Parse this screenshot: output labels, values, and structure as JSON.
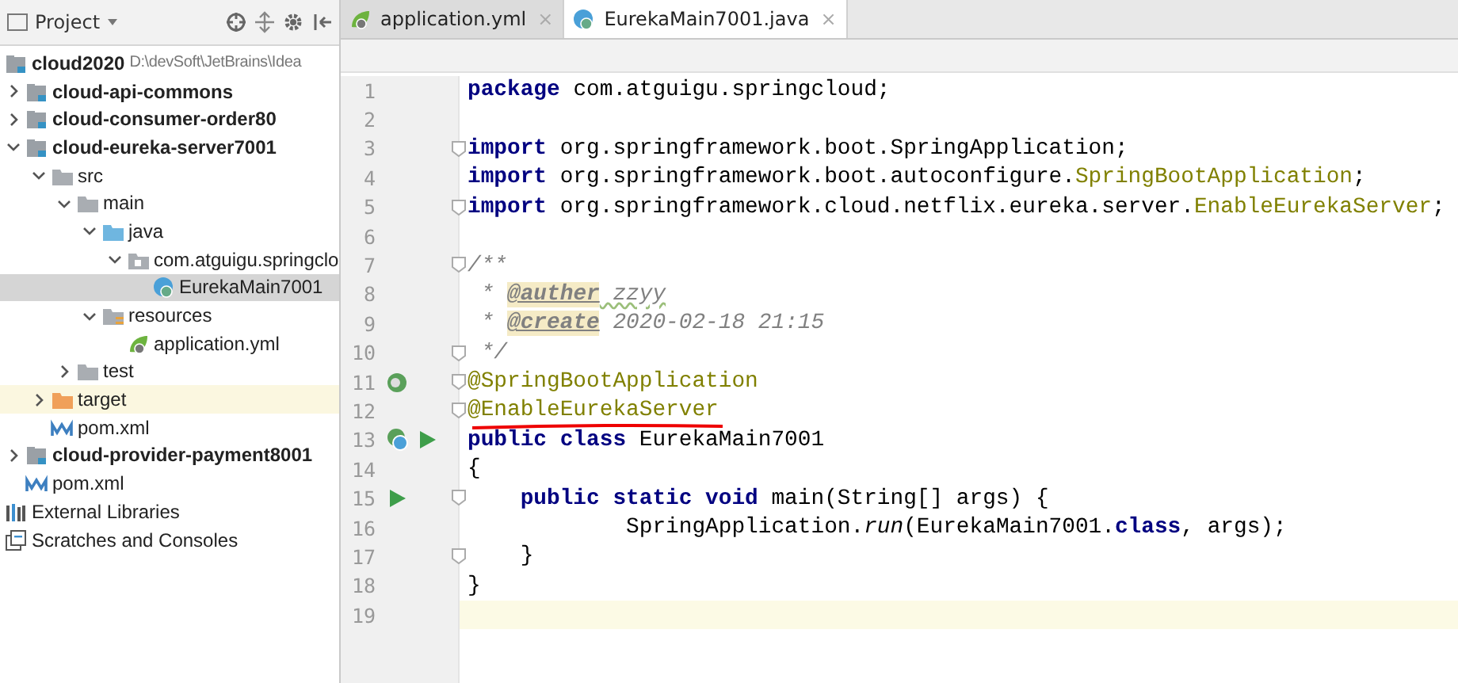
{
  "project_panel": {
    "title": "Project",
    "tree": [
      {
        "label": "cloud2020",
        "suffix": "D:\\devSoft\\JetBrains\\Idea",
        "kind": "module",
        "bold": true,
        "selected": false,
        "highlighted": false,
        "children": [
          {
            "label": "cloud-api-commons",
            "kind": "module",
            "bold": true,
            "expanded": false,
            "selected": false,
            "highlighted": false
          },
          {
            "label": "cloud-consumer-order80",
            "kind": "module",
            "bold": true,
            "expanded": false,
            "selected": false,
            "highlighted": false
          },
          {
            "label": "cloud-eureka-server7001",
            "kind": "module",
            "bold": true,
            "expanded": true,
            "selected": false,
            "highlighted": false,
            "children": [
              {
                "label": "src",
                "kind": "folder",
                "bold": false,
                "expanded": true,
                "selected": false,
                "highlighted": false,
                "children": [
                  {
                    "label": "main",
                    "kind": "folder",
                    "bold": false,
                    "expanded": true,
                    "selected": false,
                    "highlighted": false,
                    "children": [
                      {
                        "label": "java",
                        "kind": "source",
                        "bold": false,
                        "expanded": true,
                        "selected": false,
                        "highlighted": false,
                        "children": [
                          {
                            "label": "com.atguigu.springclo",
                            "kind": "package",
                            "bold": false,
                            "expanded": true,
                            "selected": false,
                            "highlighted": false,
                            "children": [
                              {
                                "label": "EurekaMain7001",
                                "kind": "class",
                                "bold": false,
                                "selected": true,
                                "highlighted": false
                              }
                            ]
                          }
                        ]
                      },
                      {
                        "label": "resources",
                        "kind": "resources",
                        "bold": false,
                        "expanded": true,
                        "selected": false,
                        "highlighted": false,
                        "children": [
                          {
                            "label": "application.yml",
                            "kind": "yml",
                            "bold": false,
                            "selected": false,
                            "highlighted": false
                          }
                        ]
                      }
                    ]
                  },
                  {
                    "label": "test",
                    "kind": "folder",
                    "bold": false,
                    "expanded": false,
                    "selected": false,
                    "highlighted": false
                  }
                ]
              },
              {
                "label": "target",
                "kind": "excluded",
                "bold": false,
                "expanded": false,
                "selected": false,
                "highlighted": true
              },
              {
                "label": "pom.xml",
                "kind": "maven",
                "bold": false,
                "selected": false,
                "highlighted": false
              }
            ]
          },
          {
            "label": "cloud-provider-payment8001",
            "kind": "module",
            "bold": true,
            "expanded": false,
            "selected": false,
            "highlighted": false
          },
          {
            "label": "pom.xml",
            "kind": "maven",
            "bold": false,
            "selected": false,
            "highlighted": false
          }
        ]
      },
      {
        "label": "External Libraries",
        "kind": "libraries",
        "bold": false,
        "selected": false,
        "highlighted": false
      },
      {
        "label": "Scratches and Consoles",
        "kind": "scratches",
        "bold": false,
        "selected": false,
        "highlighted": false
      }
    ]
  },
  "editor": {
    "tabs": [
      {
        "label": "application.yml",
        "kind": "yml",
        "close": "×",
        "selected": false
      },
      {
        "label": "EurekaMain7001.java",
        "kind": "class",
        "close": "×",
        "selected": true
      }
    ],
    "lines": [
      {
        "number": "1",
        "tokens": [
          {
            "kind": "kw",
            "text": "package"
          },
          {
            "kind": "plain",
            "text": " com.atguigu.springcloud;"
          }
        ]
      },
      {
        "number": "2"
      },
      {
        "number": "3",
        "fold": true,
        "tokens": [
          {
            "kind": "kw",
            "text": "import"
          },
          {
            "kind": "plain",
            "text": " org.springframework.boot.SpringApplication;"
          }
        ]
      },
      {
        "number": "4",
        "tokens": [
          {
            "kind": "kw",
            "text": "import"
          },
          {
            "kind": "plain",
            "text": " org.springframework.boot.autoconfigure."
          },
          {
            "kind": "ann",
            "text": "SpringBootApplication"
          },
          {
            "kind": "plain",
            "text": ";"
          }
        ]
      },
      {
        "number": "5",
        "fold": true,
        "tokens": [
          {
            "kind": "kw",
            "text": "import"
          },
          {
            "kind": "plain",
            "text": " org.springframework.cloud.netflix.eureka.server."
          },
          {
            "kind": "ann",
            "text": "EnableEurekaServer"
          },
          {
            "kind": "plain",
            "text": ";"
          }
        ]
      },
      {
        "number": "6"
      },
      {
        "number": "7",
        "fold": true,
        "tokens": [
          {
            "kind": "comment",
            "text": "/**"
          }
        ]
      },
      {
        "number": "8",
        "tokens": [
          {
            "kind": "comment",
            "text": " * "
          },
          {
            "kind": "doctag",
            "text": "@auther"
          },
          {
            "kind": "docwarn",
            "text": " zzyy"
          }
        ]
      },
      {
        "number": "9",
        "tokens": [
          {
            "kind": "comment",
            "text": " * "
          },
          {
            "kind": "doctag",
            "text": "@create"
          },
          {
            "kind": "comment",
            "text": " 2020-02-18 21:15"
          }
        ]
      },
      {
        "number": "10",
        "fold": true,
        "tokens": [
          {
            "kind": "comment",
            "text": " */"
          }
        ]
      },
      {
        "number": "11",
        "fold": true,
        "gutter": [
          {
            "kind": "bean"
          }
        ],
        "tokens": [
          {
            "kind": "ann",
            "text": "@SpringBootApplication"
          }
        ]
      },
      {
        "number": "12",
        "fold": true,
        "underlined": true,
        "tokens": [
          {
            "kind": "ann",
            "text": "@EnableEurekaServer"
          }
        ]
      },
      {
        "number": "13",
        "gutter": [
          {
            "kind": "bean-class"
          },
          {
            "kind": "run"
          }
        ],
        "tokens": [
          {
            "kind": "kw",
            "text": "public class"
          },
          {
            "kind": "plain",
            "text": " EurekaMain7001"
          }
        ]
      },
      {
        "number": "14",
        "tokens": [
          {
            "kind": "plain",
            "text": "{"
          }
        ]
      },
      {
        "number": "15",
        "fold": true,
        "gutter": [
          {
            "kind": "run"
          }
        ],
        "tokens": [
          {
            "kind": "kw",
            "text": "    public static void"
          },
          {
            "kind": "plain",
            "text": " main(String[] args) {"
          }
        ]
      },
      {
        "number": "16",
        "tokens": [
          {
            "kind": "plain",
            "text": "            SpringApplication."
          },
          {
            "kind": "static",
            "text": "run"
          },
          {
            "kind": "plain",
            "text": "(EurekaMain7001."
          },
          {
            "kind": "kw",
            "text": "class"
          },
          {
            "kind": "plain",
            "text": ", args);"
          }
        ]
      },
      {
        "number": "17",
        "fold": true,
        "tokens": [
          {
            "kind": "plain",
            "text": "    }"
          }
        ]
      },
      {
        "number": "18",
        "tokens": [
          {
            "kind": "plain",
            "text": "}"
          }
        ]
      },
      {
        "number": "19",
        "current": true
      }
    ]
  }
}
